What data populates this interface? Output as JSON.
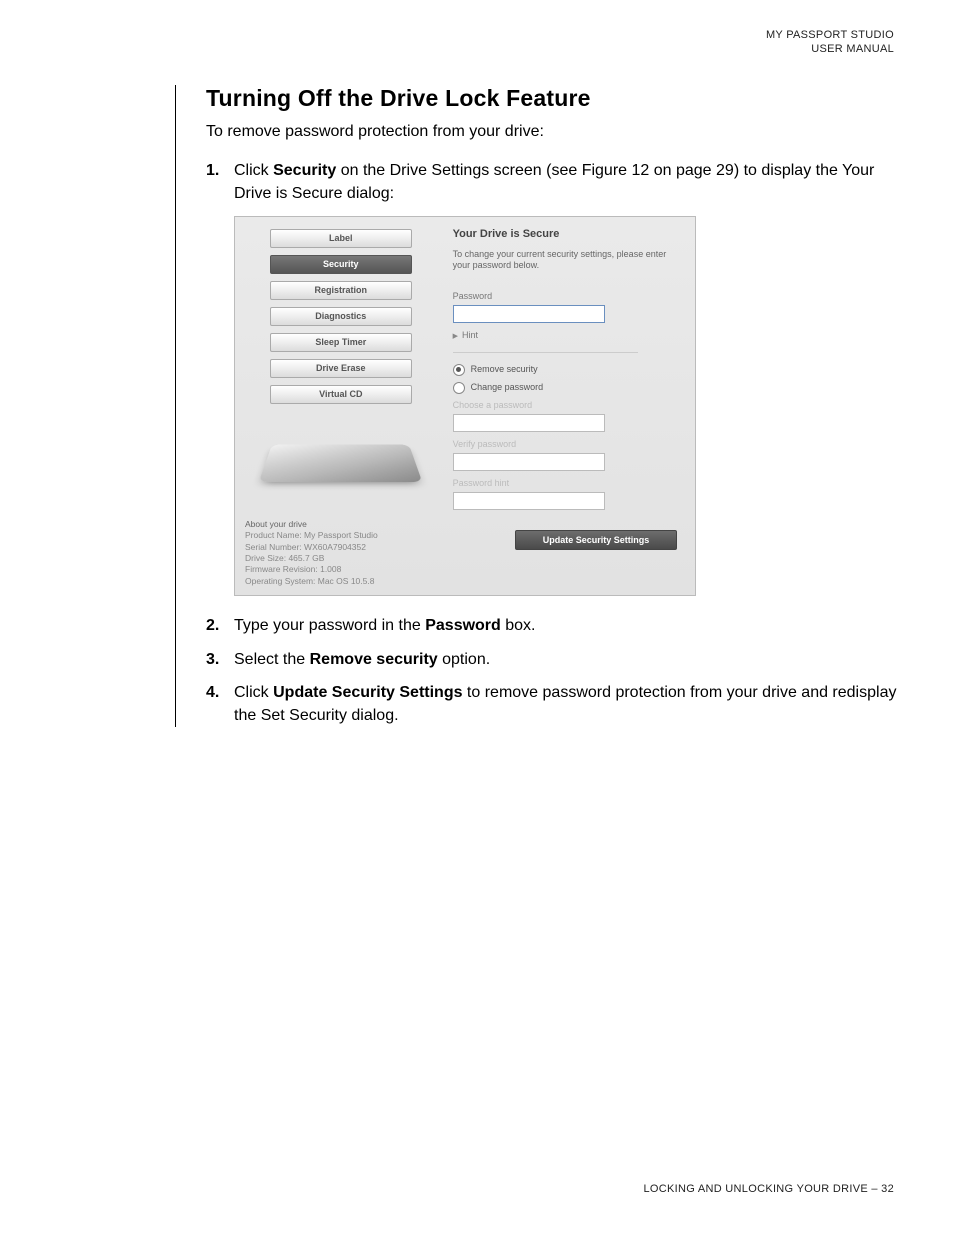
{
  "header": {
    "line1": "MY PASSPORT STUDIO",
    "line2": "USER MANUAL"
  },
  "section_title": "Turning Off the Drive Lock Feature",
  "intro": "To remove password protection from your drive:",
  "steps": {
    "s1a": "Click ",
    "s1b": "Security",
    "s1c": " on the Drive Settings screen (see Figure 12 on page 29) to display the Your Drive is Secure dialog:",
    "s2a": "Type your password in the ",
    "s2b": "Password",
    "s2c": " box.",
    "s3a": "Select the ",
    "s3b": "Remove security",
    "s3c": " option.",
    "s4a": "Click ",
    "s4b": "Update Security Settings",
    "s4c": " to remove password protection from your drive and redisplay the Set Security dialog."
  },
  "dialog": {
    "nav": [
      "Label",
      "Security",
      "Registration",
      "Diagnostics",
      "Sleep Timer",
      "Drive Erase",
      "Virtual CD"
    ],
    "about_title": "About your drive",
    "about_lines": [
      "Product Name: My Passport Studio",
      "Serial Number: WX60A7904352",
      "Drive Size: 465.7 GB",
      "Firmware Revision: 1.008",
      "Operating System: Mac OS 10.5.8"
    ],
    "title": "Your Drive is Secure",
    "subtitle": "To change your current security settings, please enter your password below.",
    "password_label": "Password",
    "hint": "Hint",
    "opt_remove": "Remove security",
    "opt_change": "Change password",
    "choose": "Choose a password",
    "verify": "Verify password",
    "phint": "Password hint",
    "update": "Update Security Settings"
  },
  "footer": "LOCKING AND UNLOCKING YOUR DRIVE – 32"
}
